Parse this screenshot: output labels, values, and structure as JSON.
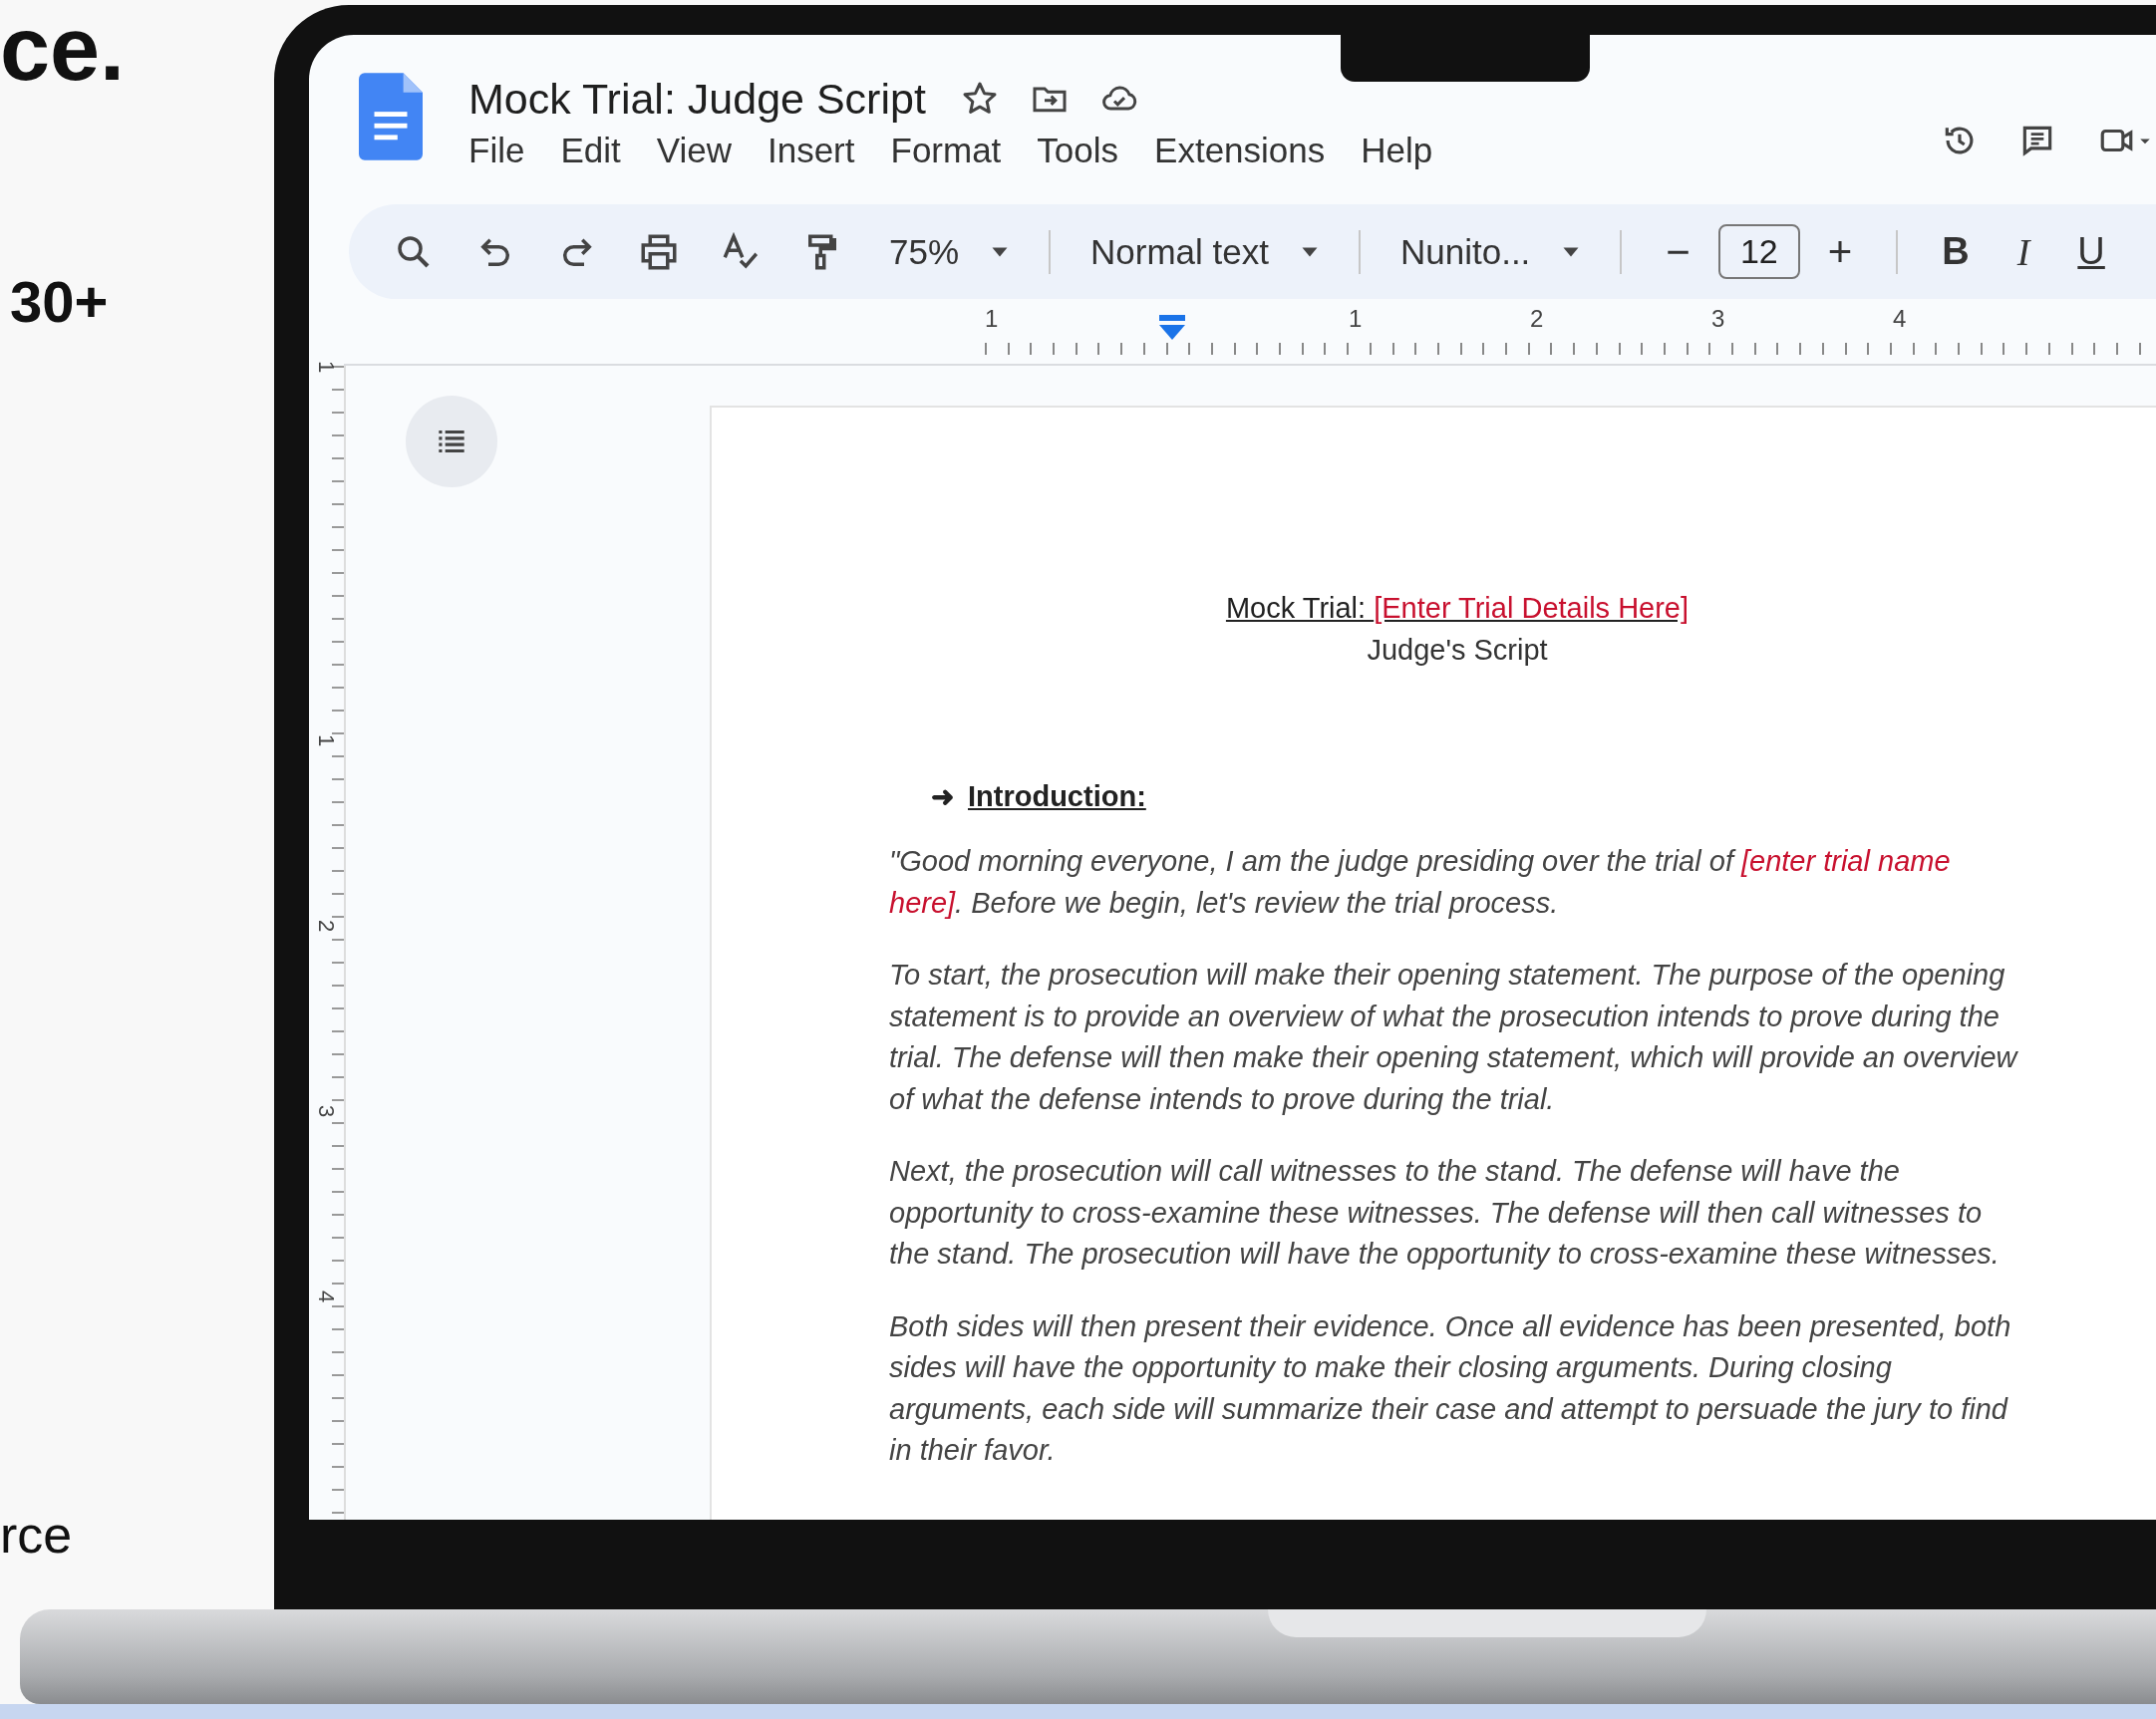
{
  "backdrop": {
    "heading_fragment": "ce.",
    "stat": "30+",
    "footer_fragment": "rce"
  },
  "docs": {
    "title": "Mock Trial: Judge Script",
    "menu": [
      "File",
      "Edit",
      "View",
      "Insert",
      "Format",
      "Tools",
      "Extensions",
      "Help"
    ],
    "toolbar": {
      "zoom": "75%",
      "style": "Normal text",
      "font": "Nunito...",
      "font_size": "12",
      "minus": "−",
      "plus": "+",
      "format_buttons": [
        "B",
        "I",
        "U"
      ]
    },
    "ruler": {
      "horizontal": [
        "1",
        "1",
        "2",
        "3",
        "4"
      ],
      "vertical": [
        "1",
        "1",
        "2",
        "3",
        "4"
      ]
    },
    "document": {
      "title": [
        {
          "kind": "plain",
          "text": "Mock Trial: "
        },
        {
          "kind": "placeholder",
          "text": "[Enter Trial Details Here]"
        }
      ],
      "subtitle": "Judge's Script",
      "heading": {
        "bullet": "➜",
        "text": "Introduction:"
      },
      "paragraphs": [
        [
          {
            "kind": "plain",
            "text": "\"Good morning everyone, I am the judge presiding over the trial of "
          },
          {
            "kind": "placeholder",
            "text": "[enter trial name here]"
          },
          {
            "kind": "plain",
            "text": ". Before we begin, let's review the trial process."
          }
        ],
        [
          {
            "kind": "plain",
            "text": "To start, the prosecution will make their opening statement. The purpose of the opening statement is to provide an overview of what the prosecution intends to prove during the trial. The defense will then make their opening statement, which will provide an overview of what the defense intends to prove during the trial."
          }
        ],
        [
          {
            "kind": "plain",
            "text": "Next, the prosecution will call witnesses to the stand. The defense will have the opportunity to cross-examine these witnesses. The defense will then call witnesses to the stand. The prosecution will have the opportunity to cross-examine these witnesses."
          }
        ],
        [
          {
            "kind": "plain",
            "text": "Both sides will then present their evidence. Once all evidence has been presented, both sides will have the opportunity to make their closing arguments. During closing arguments, each side will summarize their case and attempt to persuade the jury to find in their favor."
          }
        ]
      ]
    }
  }
}
